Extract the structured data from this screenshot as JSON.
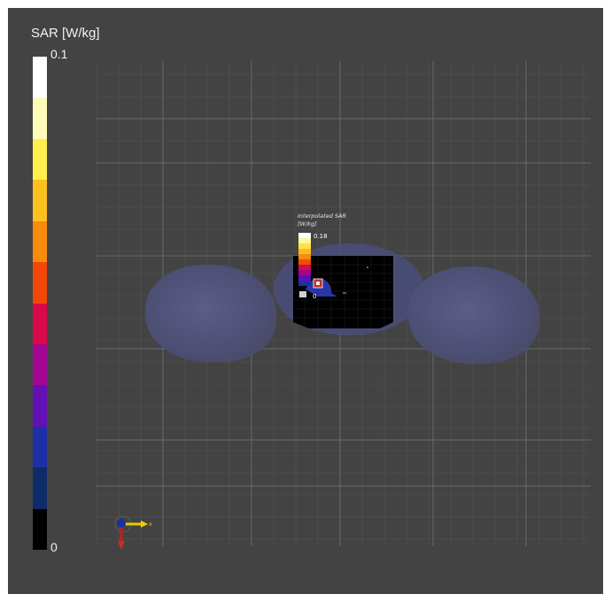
{
  "colorbar": {
    "title": "SAR [W/kg]",
    "max_label": "0.1",
    "min_label": "0",
    "colors": [
      "#ffffff",
      "#fefbb8",
      "#fdf04a",
      "#fcc11f",
      "#f98b0b",
      "#f24708",
      "#d9084a",
      "#a30592",
      "#6310b6",
      "#1d2fa6",
      "#0e2c68",
      "#000000"
    ]
  },
  "inset_colorbar": {
    "title_line1": "Interpolated SAR",
    "title_line2": "[W/kg]",
    "max_label": "0.18",
    "min_label": "0",
    "colors": [
      "#ffffff",
      "#fef7a0",
      "#fde24d",
      "#fcba1e",
      "#f78c0d",
      "#ef4e0a",
      "#d60b46",
      "#a10591",
      "#5b12b3",
      "#1d2fa6"
    ]
  },
  "axis_triad": {
    "label": "x"
  }
}
